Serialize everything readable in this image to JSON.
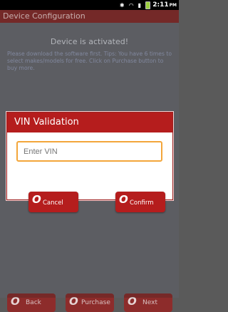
{
  "status_bar": {
    "time": "2:11",
    "time_suffix": "PM"
  },
  "title": "Device Configuration",
  "activated_text": "Device is activated!",
  "tips_text": "Please download the software first. Tips: You have 6 times to select makes/models for free. Click on Purchase button to buy more.",
  "dialog": {
    "title": "VIN Validation",
    "vin_placeholder": "Enter VIN",
    "cancel_label": "Cancel",
    "confirm_label": "Confirm"
  },
  "bottom_buttons": {
    "back": "Back",
    "purchase": "Purchase",
    "next": "Next"
  }
}
